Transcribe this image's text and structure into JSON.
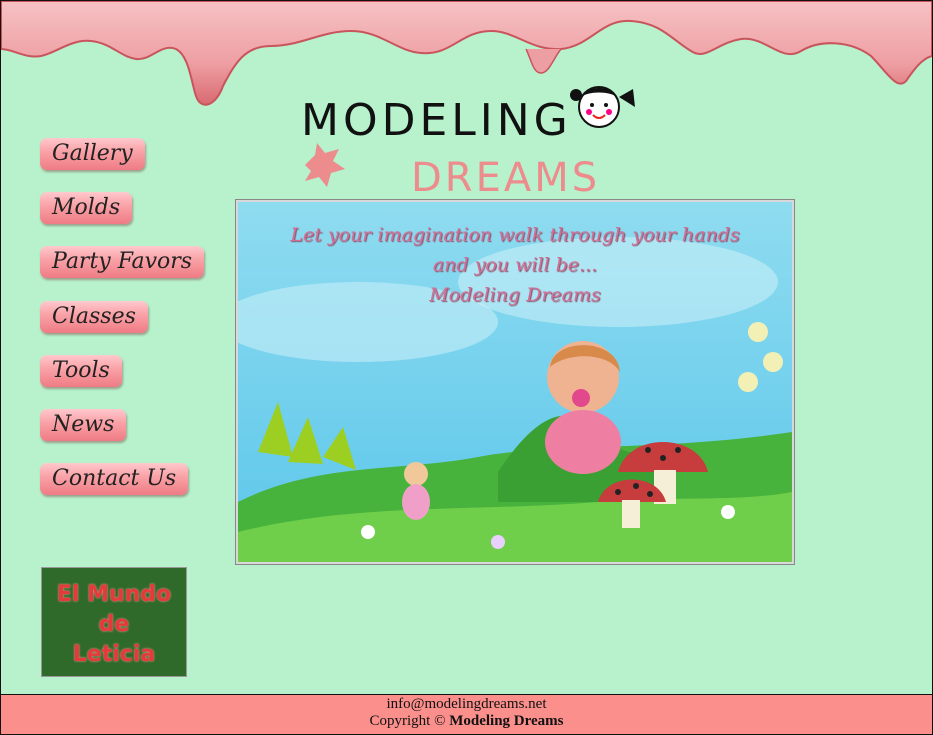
{
  "brand": {
    "line1": "MODELING",
    "line2": "DREAMS"
  },
  "nav": [
    {
      "label": "Gallery"
    },
    {
      "label": "Molds"
    },
    {
      "label": "Party Favors"
    },
    {
      "label": "Classes"
    },
    {
      "label": "Tools"
    },
    {
      "label": "News"
    },
    {
      "label": "Contact Us"
    }
  ],
  "hero": {
    "tagline_1": "Let your imagination walk through your hands",
    "tagline_2": "and you will be...",
    "tagline_3": "Modeling Dreams"
  },
  "badge": {
    "line1": "El Mundo",
    "line2": "de",
    "line3": "Leticia"
  },
  "footer": {
    "email": "info@modelingdreams.net",
    "copyright_prefix": "Copyright ©",
    "copyright_name": "Modeling Dreams"
  },
  "colors": {
    "background": "#b7f2cd",
    "footer": "#fb8f8c",
    "nav_button": "#f49aa0",
    "drip": "#e77f84"
  }
}
